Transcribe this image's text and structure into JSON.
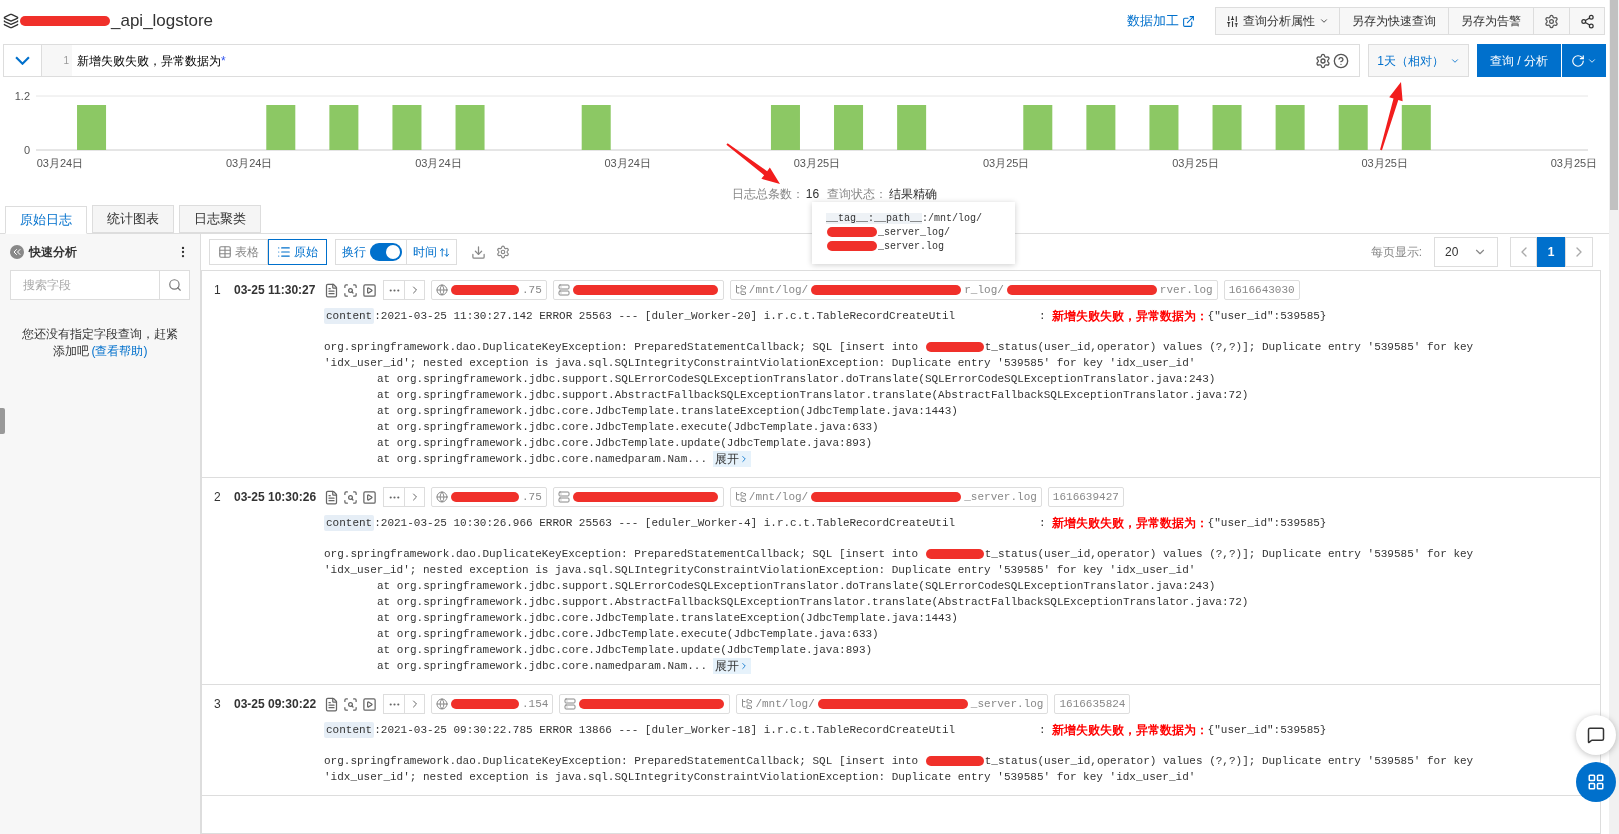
{
  "header": {
    "title_suffix": "_api_logstore",
    "link": "数据加工",
    "buttons": [
      {
        "kind": "menu",
        "label": "查询分析属性"
      },
      {
        "kind": "plain",
        "label": "另存为快速查询"
      },
      {
        "kind": "plain",
        "label": "另存为告警"
      },
      {
        "kind": "settings"
      }
    ]
  },
  "query": {
    "line_number": "1",
    "text": "新增失败失败，异常数据为",
    "wildcard": "*",
    "time_range": "1天（相对）",
    "submit": "查询 / 分析"
  },
  "chart": {
    "chart_data": {
      "type": "bar",
      "categories": [
        "03月24日",
        null,
        null,
        "03月24日",
        null,
        null,
        "03月24日",
        null,
        null,
        "03月24日",
        null,
        null,
        "03月25日",
        null,
        null,
        "03月25日",
        null,
        null,
        "03月25日",
        null,
        null,
        "03月25日",
        null,
        null,
        "03月25日"
      ],
      "series": [
        {
          "color": "#8cc864",
          "values": [
            1,
            0,
            0,
            1,
            1,
            1,
            1,
            0,
            1,
            0,
            0,
            1,
            1,
            1,
            0,
            1,
            1,
            1,
            1,
            1,
            1,
            1,
            0,
            0,
            null
          ]
        }
      ],
      "ylim": [
        0,
        1.2
      ],
      "yticks": [
        0,
        {
          "value": 1.2,
          "label": "1.2"
        }
      ]
    }
  },
  "summary": {
    "count_label": "日志总条数：",
    "count": "16",
    "status_label": "查询状态：",
    "status": "结果精确"
  },
  "tabs": [
    {
      "label": "原始日志",
      "selected": true
    },
    {
      "label": "统计图表",
      "selected": false
    },
    {
      "label": "日志聚类",
      "selected": false
    }
  ],
  "sidebar": {
    "title": "快速分析",
    "search": {
      "placeholder": "搜索字段"
    },
    "empty_message": "您还没有指定字段查询，赶紧添加吧",
    "help_link": "(查看帮助)"
  },
  "toolbar": {
    "views": [
      {
        "kind": "table",
        "label": "表格",
        "selected": false
      },
      {
        "kind": "raw",
        "label": "原始",
        "selected": true
      }
    ],
    "wrap": {
      "label": "换行",
      "on": true
    },
    "sort": {
      "label": "时间"
    },
    "page_size_label": "每页显示:",
    "page_size": "20",
    "pages": [
      {
        "label": "1",
        "selected": true
      }
    ]
  },
  "tooltip": {
    "key": "__tag__:__path__",
    "parts": [
      ":/mnt/log/",
      "_server_log/",
      "_server.log"
    ]
  },
  "logs": [
    {
      "index": "1",
      "time": "03-25 11:30:27",
      "tags": [
        {
          "kind": "ip",
          "parts": [
            ".75"
          ]
        },
        {
          "kind": "host"
        },
        {
          "kind": "path",
          "parts": [
            "/mnt/log/",
            "r_log/",
            "rver.log"
          ]
        },
        {
          "kind": "time",
          "parts": [
            "1616643030"
          ]
        }
      ],
      "content_key": "content",
      "content_line": ":2021-03-25 11:30:27.142 ERROR 25563 --- [duler_Worker-20] i.r.c.t.TableRecordCreateUtil",
      "separator": ":",
      "message": "新增失败失败，异常数据为：",
      "value": "{\"user_id\":539585}",
      "lines": [
        {
          "kind": "message",
          "parts": [
            "org.springframework.dao.DuplicateKeyException: PreparedStatementCallback; SQL [insert into ",
            "t_status(user_id,operator) values (?,?)]; Duplicate entry '539585' for key"
          ]
        },
        {
          "kind": "message",
          "parts": [
            "'idx_user_id'; nested exception is java.sql.SQLIntegrityConstraintViolationException: Duplicate entry '539585' for key 'idx_user_id'"
          ]
        },
        {
          "kind": "frame",
          "parts": [
            "at org.springframework.jdbc.support.SQLErrorCodeSQLExceptionTranslator.doTranslate(SQLErrorCodeSQLExceptionTranslator.java:243)"
          ]
        },
        {
          "kind": "frame",
          "parts": [
            "at org.springframework.jdbc.support.AbstractFallbackSQLExceptionTranslator.translate(AbstractFallbackSQLExceptionTranslator.java:72)"
          ]
        },
        {
          "kind": "frame",
          "parts": [
            "at org.springframework.jdbc.core.JdbcTemplate.translateException(JdbcTemplate.java:1443)"
          ]
        },
        {
          "kind": "frame",
          "parts": [
            "at org.springframework.jdbc.core.JdbcTemplate.execute(JdbcTemplate.java:633)"
          ]
        },
        {
          "kind": "frame",
          "parts": [
            "at org.springframework.jdbc.core.JdbcTemplate.update(JdbcTemplate.java:893)"
          ]
        },
        {
          "kind": "frame",
          "parts": [
            "at org.springframework.jdbc.core.namedparam.Nam..."
          ]
        }
      ],
      "expand_label": "展开"
    },
    {
      "index": "2",
      "time": "03-25 10:30:26",
      "tags": [
        {
          "kind": "ip",
          "parts": [
            ".75"
          ]
        },
        {
          "kind": "host"
        },
        {
          "kind": "path",
          "parts": [
            "/mnt/log/",
            "_server.log"
          ]
        },
        {
          "kind": "time",
          "parts": [
            "1616639427"
          ]
        }
      ],
      "content_key": "content",
      "content_line": ":2021-03-25 10:30:26.966 ERROR 25563 --- [eduler_Worker-4] i.r.c.t.TableRecordCreateUtil",
      "separator": ":",
      "message": "新增失败失败，异常数据为：",
      "value": "{\"user_id\":539585}",
      "lines": [
        {
          "kind": "message",
          "parts": [
            "org.springframework.dao.DuplicateKeyException: PreparedStatementCallback; SQL [insert into ",
            "t_status(user_id,operator) values (?,?)]; Duplicate entry '539585' for key"
          ]
        },
        {
          "kind": "message",
          "parts": [
            "'idx_user_id'; nested exception is java.sql.SQLIntegrityConstraintViolationException: Duplicate entry '539585' for key 'idx_user_id'"
          ]
        },
        {
          "kind": "frame",
          "parts": [
            "at org.springframework.jdbc.support.SQLErrorCodeSQLExceptionTranslator.doTranslate(SQLErrorCodeSQLExceptionTranslator.java:243)"
          ]
        },
        {
          "kind": "frame",
          "parts": [
            "at org.springframework.jdbc.support.AbstractFallbackSQLExceptionTranslator.translate(AbstractFallbackSQLExceptionTranslator.java:72)"
          ]
        },
        {
          "kind": "frame",
          "parts": [
            "at org.springframework.jdbc.core.JdbcTemplate.translateException(JdbcTemplate.java:1443)"
          ]
        },
        {
          "kind": "frame",
          "parts": [
            "at org.springframework.jdbc.core.JdbcTemplate.execute(JdbcTemplate.java:633)"
          ]
        },
        {
          "kind": "frame",
          "parts": [
            "at org.springframework.jdbc.core.JdbcTemplate.update(JdbcTemplate.java:893)"
          ]
        },
        {
          "kind": "frame",
          "parts": [
            "at org.springframework.jdbc.core.namedparam.Nam..."
          ]
        }
      ],
      "expand_label": "展开"
    },
    {
      "index": "3",
      "time": "03-25 09:30:22",
      "tags": [
        {
          "kind": "ip",
          "parts": [
            ".154"
          ]
        },
        {
          "kind": "host"
        },
        {
          "kind": "path",
          "parts": [
            "/mnt/log/",
            "_server.log"
          ]
        },
        {
          "kind": "time",
          "parts": [
            "1616635824"
          ]
        }
      ],
      "content_key": "content",
      "content_line": ":2021-03-25 09:30:22.785 ERROR 13866 --- [duler_Worker-18] i.r.c.t.TableRecordCreateUtil",
      "separator": ":",
      "message": "新增失败失败，异常数据为：",
      "value": "{\"user_id\":539585}",
      "lines": [
        {
          "kind": "message",
          "parts": [
            "org.springframework.dao.DuplicateKeyException: PreparedStatementCallback; SQL [insert into ",
            "t_status(user_id,operator) values (?,?)]; Duplicate entry '539585' for key"
          ]
        },
        {
          "kind": "message",
          "parts": [
            "'idx_user_id'; nested exception is java.sql.SQLIntegrityConstraintViolationException: Duplicate entry '539585' for key 'idx_user_id'"
          ]
        }
      ]
    }
  ]
}
